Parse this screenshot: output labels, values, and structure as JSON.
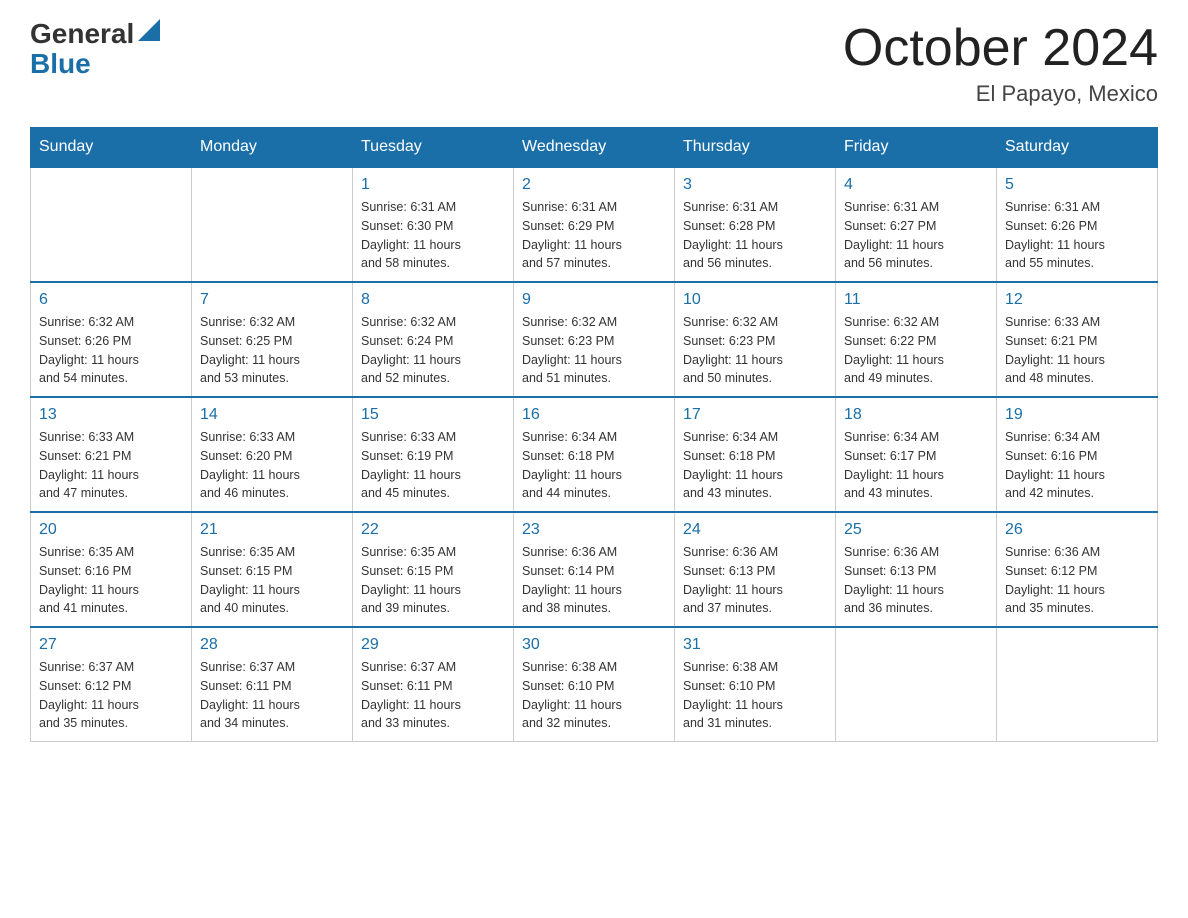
{
  "logo": {
    "general": "General",
    "blue": "Blue"
  },
  "title": "October 2024",
  "subtitle": "El Papayo, Mexico",
  "days_of_week": [
    "Sunday",
    "Monday",
    "Tuesday",
    "Wednesday",
    "Thursday",
    "Friday",
    "Saturday"
  ],
  "weeks": [
    [
      {
        "day": "",
        "info": ""
      },
      {
        "day": "",
        "info": ""
      },
      {
        "day": "1",
        "info": "Sunrise: 6:31 AM\nSunset: 6:30 PM\nDaylight: 11 hours\nand 58 minutes."
      },
      {
        "day": "2",
        "info": "Sunrise: 6:31 AM\nSunset: 6:29 PM\nDaylight: 11 hours\nand 57 minutes."
      },
      {
        "day": "3",
        "info": "Sunrise: 6:31 AM\nSunset: 6:28 PM\nDaylight: 11 hours\nand 56 minutes."
      },
      {
        "day": "4",
        "info": "Sunrise: 6:31 AM\nSunset: 6:27 PM\nDaylight: 11 hours\nand 56 minutes."
      },
      {
        "day": "5",
        "info": "Sunrise: 6:31 AM\nSunset: 6:26 PM\nDaylight: 11 hours\nand 55 minutes."
      }
    ],
    [
      {
        "day": "6",
        "info": "Sunrise: 6:32 AM\nSunset: 6:26 PM\nDaylight: 11 hours\nand 54 minutes."
      },
      {
        "day": "7",
        "info": "Sunrise: 6:32 AM\nSunset: 6:25 PM\nDaylight: 11 hours\nand 53 minutes."
      },
      {
        "day": "8",
        "info": "Sunrise: 6:32 AM\nSunset: 6:24 PM\nDaylight: 11 hours\nand 52 minutes."
      },
      {
        "day": "9",
        "info": "Sunrise: 6:32 AM\nSunset: 6:23 PM\nDaylight: 11 hours\nand 51 minutes."
      },
      {
        "day": "10",
        "info": "Sunrise: 6:32 AM\nSunset: 6:23 PM\nDaylight: 11 hours\nand 50 minutes."
      },
      {
        "day": "11",
        "info": "Sunrise: 6:32 AM\nSunset: 6:22 PM\nDaylight: 11 hours\nand 49 minutes."
      },
      {
        "day": "12",
        "info": "Sunrise: 6:33 AM\nSunset: 6:21 PM\nDaylight: 11 hours\nand 48 minutes."
      }
    ],
    [
      {
        "day": "13",
        "info": "Sunrise: 6:33 AM\nSunset: 6:21 PM\nDaylight: 11 hours\nand 47 minutes."
      },
      {
        "day": "14",
        "info": "Sunrise: 6:33 AM\nSunset: 6:20 PM\nDaylight: 11 hours\nand 46 minutes."
      },
      {
        "day": "15",
        "info": "Sunrise: 6:33 AM\nSunset: 6:19 PM\nDaylight: 11 hours\nand 45 minutes."
      },
      {
        "day": "16",
        "info": "Sunrise: 6:34 AM\nSunset: 6:18 PM\nDaylight: 11 hours\nand 44 minutes."
      },
      {
        "day": "17",
        "info": "Sunrise: 6:34 AM\nSunset: 6:18 PM\nDaylight: 11 hours\nand 43 minutes."
      },
      {
        "day": "18",
        "info": "Sunrise: 6:34 AM\nSunset: 6:17 PM\nDaylight: 11 hours\nand 43 minutes."
      },
      {
        "day": "19",
        "info": "Sunrise: 6:34 AM\nSunset: 6:16 PM\nDaylight: 11 hours\nand 42 minutes."
      }
    ],
    [
      {
        "day": "20",
        "info": "Sunrise: 6:35 AM\nSunset: 6:16 PM\nDaylight: 11 hours\nand 41 minutes."
      },
      {
        "day": "21",
        "info": "Sunrise: 6:35 AM\nSunset: 6:15 PM\nDaylight: 11 hours\nand 40 minutes."
      },
      {
        "day": "22",
        "info": "Sunrise: 6:35 AM\nSunset: 6:15 PM\nDaylight: 11 hours\nand 39 minutes."
      },
      {
        "day": "23",
        "info": "Sunrise: 6:36 AM\nSunset: 6:14 PM\nDaylight: 11 hours\nand 38 minutes."
      },
      {
        "day": "24",
        "info": "Sunrise: 6:36 AM\nSunset: 6:13 PM\nDaylight: 11 hours\nand 37 minutes."
      },
      {
        "day": "25",
        "info": "Sunrise: 6:36 AM\nSunset: 6:13 PM\nDaylight: 11 hours\nand 36 minutes."
      },
      {
        "day": "26",
        "info": "Sunrise: 6:36 AM\nSunset: 6:12 PM\nDaylight: 11 hours\nand 35 minutes."
      }
    ],
    [
      {
        "day": "27",
        "info": "Sunrise: 6:37 AM\nSunset: 6:12 PM\nDaylight: 11 hours\nand 35 minutes."
      },
      {
        "day": "28",
        "info": "Sunrise: 6:37 AM\nSunset: 6:11 PM\nDaylight: 11 hours\nand 34 minutes."
      },
      {
        "day": "29",
        "info": "Sunrise: 6:37 AM\nSunset: 6:11 PM\nDaylight: 11 hours\nand 33 minutes."
      },
      {
        "day": "30",
        "info": "Sunrise: 6:38 AM\nSunset: 6:10 PM\nDaylight: 11 hours\nand 32 minutes."
      },
      {
        "day": "31",
        "info": "Sunrise: 6:38 AM\nSunset: 6:10 PM\nDaylight: 11 hours\nand 31 minutes."
      },
      {
        "day": "",
        "info": ""
      },
      {
        "day": "",
        "info": ""
      }
    ]
  ]
}
